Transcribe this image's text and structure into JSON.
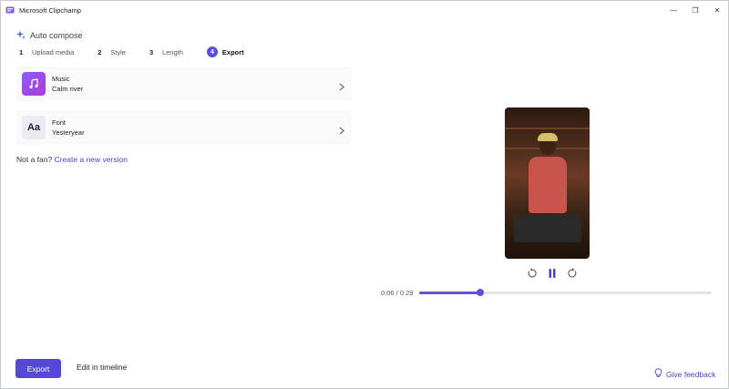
{
  "window": {
    "title": "Microsoft Clipchamp",
    "controls": {
      "minimize": "—",
      "restore": "❐",
      "close": "✕"
    }
  },
  "header": {
    "auto_compose_label": "Auto compose",
    "icon": "sparkle-icon"
  },
  "steps": [
    {
      "num": "1",
      "label": "Upload media"
    },
    {
      "num": "2",
      "label": "Style"
    },
    {
      "num": "3",
      "label": "Length"
    },
    {
      "num": "4",
      "label": "Export",
      "active": true
    }
  ],
  "options": {
    "music": {
      "title": "Music",
      "value": "Calm river",
      "icon": "music-note-icon"
    },
    "font": {
      "title": "Font",
      "value": "Yesteryear",
      "icon_text": "Aa"
    }
  },
  "not_fan": {
    "text": "Not a fan?",
    "link": "Create a new version"
  },
  "player": {
    "time_display": "0:06 / 0:29",
    "progress_fraction": 0.21
  },
  "actions": {
    "export_label": "Export",
    "edit_label": "Edit in timeline",
    "feedback_label": "Give feedback"
  },
  "colors": {
    "accent": "#5548d9",
    "link": "#4b45c7"
  }
}
